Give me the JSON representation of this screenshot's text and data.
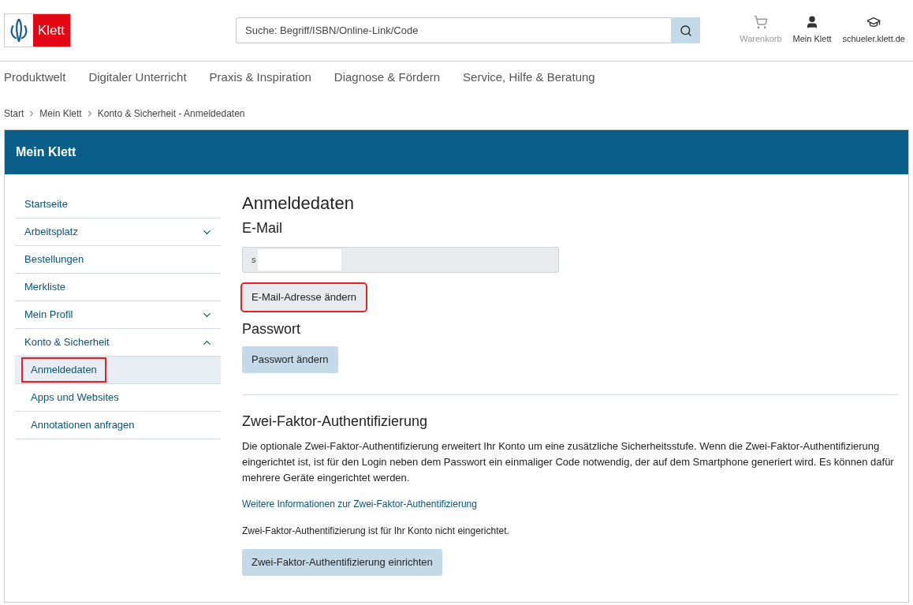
{
  "logo": {
    "text": "Klett"
  },
  "search": {
    "placeholder": "Suche: Begriff/ISBN/Online-Link/Code"
  },
  "header_links": [
    {
      "kind": "cart",
      "label": "Warenkorb",
      "disabled": true
    },
    {
      "kind": "user",
      "label": "Mein Klett",
      "disabled": false
    },
    {
      "kind": "student",
      "label": "schueler.klett.de",
      "disabled": false
    }
  ],
  "nav": [
    "Produktwelt",
    "Digitaler Unterricht",
    "Praxis & Inspiration",
    "Diagnose & Fördern",
    "Service, Hilfe & Beratung"
  ],
  "breadcrumb": [
    "Start",
    "Mein Klett",
    "Konto & Sicherheit - Anmeldedaten"
  ],
  "panel_title": "Mein Klett",
  "sidebar": [
    {
      "label": "Startseite",
      "selected": false,
      "highlighted": false
    },
    {
      "label": "Arbeitsplatz",
      "expanded": false,
      "selected": false,
      "highlighted": false
    },
    {
      "label": "Bestellungen",
      "selected": false,
      "highlighted": false
    },
    {
      "label": "Merkliste",
      "selected": false,
      "highlighted": false
    },
    {
      "label": "Mein Profil",
      "expanded": false,
      "selected": false,
      "highlighted": false
    },
    {
      "label": "Konto & Sicherheit",
      "expanded": true,
      "selected": false,
      "highlighted": false,
      "children": [
        {
          "label": "Anmeldedaten",
          "selected": true,
          "highlighted": true
        },
        {
          "label": "Apps und Websites",
          "selected": false,
          "highlighted": false
        },
        {
          "label": "Annotationen anfragen",
          "selected": false,
          "highlighted": false
        }
      ]
    }
  ],
  "content": {
    "title": "Anmeldedaten",
    "email_heading": "E-Mail",
    "email_value": "s",
    "email_button": {
      "label": "E-Mail-Adresse ändern",
      "highlighted": true
    },
    "password_heading": "Passwort",
    "password_button": {
      "label": "Passwort ändern",
      "highlighted": false
    },
    "tfa_heading": "Zwei-Faktor-Authentifizierung",
    "tfa_text": "Die optionale Zwei-Faktor-Authentifizierung erweitert Ihr Konto um eine zusätzliche Sicherheitsstufe. Wenn die Zwei-Faktor-Authentifizierung eingerichtet ist, ist für den Login neben dem Passwort ein einmaliger Code notwendig, der auf dem Smartphone generiert wird. Es können dafür mehrere Geräte eingerichtet werden.",
    "tfa_link": "Weitere Informationen zur Zwei-Faktor-Authentifizierung",
    "tfa_status": "Zwei-Faktor-Authentifizierung ist für Ihr Konto nicht eingerichtet.",
    "tfa_button": {
      "label": "Zwei-Faktor-Authentifizierung einrichten",
      "highlighted": false
    }
  }
}
